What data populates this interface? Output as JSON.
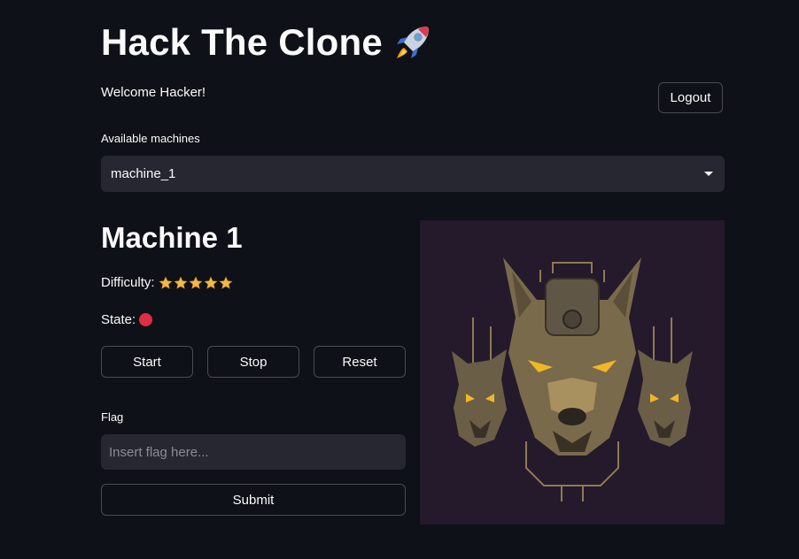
{
  "app": {
    "title": "Hack The Clone",
    "title_icon": "rocket-icon",
    "welcome": "Welcome Hacker!",
    "logout_label": "Logout"
  },
  "machines": {
    "label": "Available machines",
    "selected": "machine_1"
  },
  "machine": {
    "title": "Machine 1",
    "difficulty_label": "Difficulty:",
    "difficulty_stars": 5,
    "state_label": "State:",
    "state_color": "#dd2e44",
    "image_icon": "three-headed-cyber-dog-artwork"
  },
  "actions": {
    "start_label": "Start",
    "stop_label": "Stop",
    "reset_label": "Reset"
  },
  "flag": {
    "label": "Flag",
    "placeholder": "Insert flag here...",
    "value": "",
    "submit_label": "Submit"
  },
  "colors": {
    "background": "#0e1117",
    "input_bg": "#262730",
    "star": "#f4b942",
    "state_stopped": "#dd2e44"
  }
}
